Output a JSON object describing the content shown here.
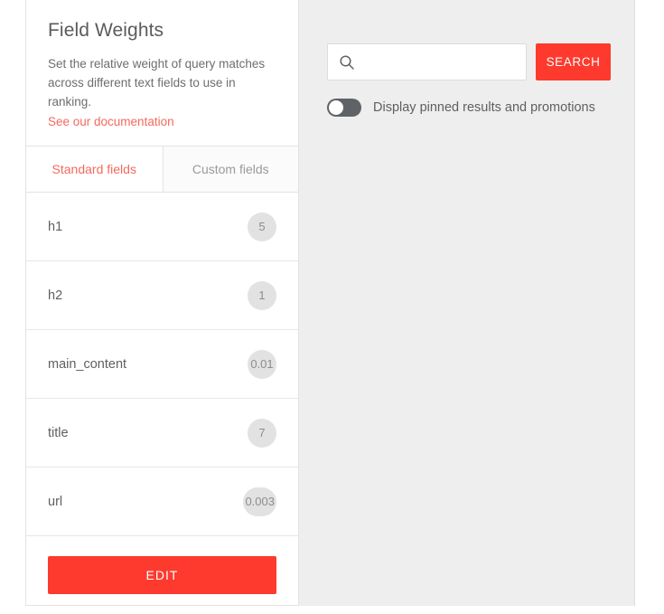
{
  "settings_card": {
    "title": "Field Weights",
    "description": "Set the relative weight of query matches across different text fields to use in ranking.",
    "doc_link_label": "See our documentation",
    "tabs": [
      {
        "label": "Standard fields",
        "active": true
      },
      {
        "label": "Custom fields",
        "active": false
      }
    ],
    "fields": [
      {
        "name": "h1",
        "weight": "5"
      },
      {
        "name": "h2",
        "weight": "1"
      },
      {
        "name": "main_content",
        "weight": "0.01"
      },
      {
        "name": "title",
        "weight": "7"
      },
      {
        "name": "url",
        "weight": "0.003"
      }
    ],
    "edit_button_label": "EDIT"
  },
  "preview_panel": {
    "search": {
      "icon": "search-icon",
      "value": "",
      "placeholder": "",
      "button_label": "SEARCH"
    },
    "pinned_toggle": {
      "label": "Display pinned results and promotions",
      "state": "off"
    }
  },
  "colors": {
    "accent_red": "#fd3a2d",
    "link_red": "#f4695f",
    "panel_background": "#eeeeee",
    "badge_background": "#e2e2e2",
    "toggle_track_off": "#5f6368"
  }
}
